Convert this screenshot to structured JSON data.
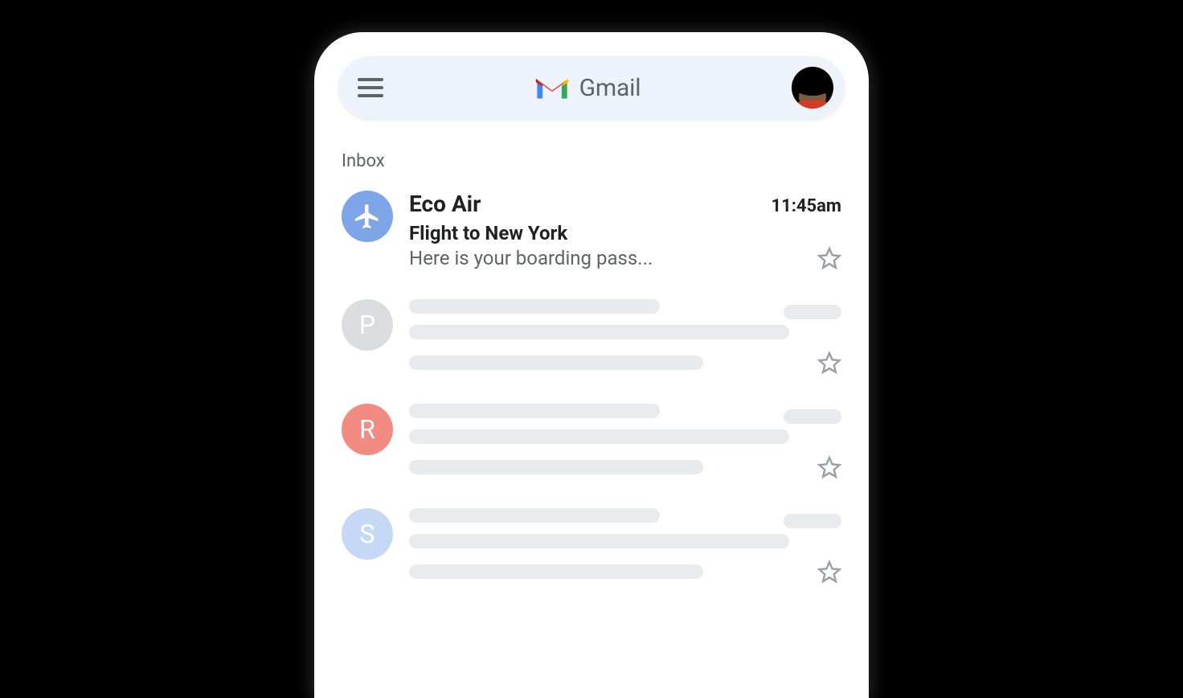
{
  "header": {
    "brand": "Gmail"
  },
  "section_label": "Inbox",
  "emails": [
    {
      "sender": "Eco Air",
      "time": "11:45am",
      "subject": "Flight to New York",
      "snippet": "Here is your boarding pass...",
      "avatar_type": "plane",
      "avatar_color": "#7da5e8",
      "starred": false,
      "unread": true
    },
    {
      "sender": "",
      "avatar_letter": "P",
      "avatar_color": "#dadce0",
      "placeholder": true,
      "starred": false
    },
    {
      "sender": "",
      "avatar_letter": "R",
      "avatar_color": "#f28b82",
      "placeholder": true,
      "starred": false
    },
    {
      "sender": "",
      "avatar_letter": "S",
      "avatar_color": "#c5d9f7",
      "placeholder": true,
      "starred": false
    }
  ]
}
